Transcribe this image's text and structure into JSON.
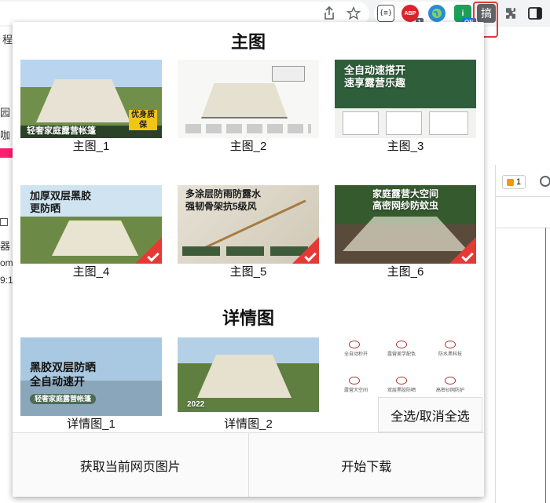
{
  "toolbar": {
    "ext_json_label": "{≡}",
    "ext_abp_label": "ABP",
    "ext_abp_badge": "1",
    "ext_on_label": "i",
    "ext_on_badge": "ON",
    "ext_gao_label": "搞"
  },
  "background_page": {
    "frag_1": "程",
    "frag_2": "园",
    "frag_3": "咖",
    "frag_4": "器",
    "frag_5": "om.",
    "frag_6": "9:1",
    "warning_count": "1"
  },
  "popup": {
    "main_section_title": "主图",
    "detail_section_title": "详情图",
    "main_images": [
      {
        "label": "主图_1",
        "overlay_line1": "轻奢家庭露营帐篷",
        "overlay_line2": "优身质保",
        "checked": false
      },
      {
        "label": "主图_2",
        "overlay_line1": "",
        "overlay_line2": "",
        "checked": false
      },
      {
        "label": "主图_3",
        "overlay_line1": "全自动速搭开",
        "overlay_line2": "速享露营乐趣",
        "checked": false
      },
      {
        "label": "主图_4",
        "overlay_line1": "加厚双层黑胶",
        "overlay_line2": "更防晒",
        "checked": true
      },
      {
        "label": "主图_5",
        "overlay_line1": "多涂层防雨防露水",
        "overlay_line2": "强韧骨架抗5级风",
        "checked": true
      },
      {
        "label": "主图_6",
        "overlay_line1": "家庭露营大空间",
        "overlay_line2": "高密网纱防蚊虫",
        "checked": true
      }
    ],
    "detail_images": [
      {
        "label": "详情图_1",
        "overlay_line1": "黑胶双层防晒",
        "overlay_line2": "全自动速开",
        "overlay_line3": "轻奢家庭露营帐篷"
      },
      {
        "label": "详情图_2",
        "overlay_line1": "2022",
        "overlay_line2": "",
        "overlay_line3": ""
      },
      {
        "label": "",
        "overlay_line1": "全自动秒开",
        "overlay_line2": "露营美学配色",
        "overlay_line3": "防水黑科技"
      }
    ],
    "detail_icon_labels": [
      "全自动秒开",
      "露营美学配色",
      "防水黑科技",
      "露营大空间",
      "双层黑胶防晒",
      "高密纱网防护"
    ],
    "select_all_label": "全选/取消全选",
    "fetch_images_label": "获取当前网页图片",
    "start_download_label": "开始下载"
  },
  "colors": {
    "accent_red": "#e53935",
    "pink_bar": "#ff1f6e",
    "popup_bg": "#ffffff"
  }
}
